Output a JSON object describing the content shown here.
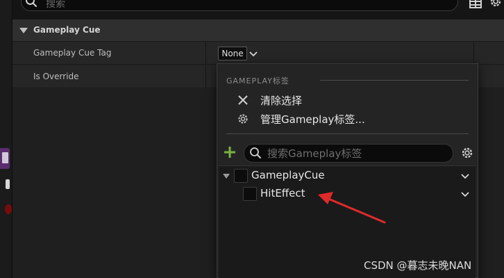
{
  "top_bar": {
    "search_placeholder": "搜索"
  },
  "details": {
    "category_title": "Gameplay Cue",
    "properties": [
      {
        "name": "Gameplay Cue Tag",
        "value": "None"
      },
      {
        "name": "Is Override"
      }
    ]
  },
  "popup": {
    "section_title": "GAMEPLAY标签",
    "menu": [
      {
        "label": "清除选择",
        "icon": "close-icon"
      },
      {
        "label": "管理Gameplay标签...",
        "icon": "gear-icon"
      }
    ],
    "search_placeholder": "搜索Gameplay标签",
    "tree": [
      {
        "label": "GameplayCue",
        "expanded": true,
        "checked": false
      },
      {
        "label": "HitEffect",
        "expanded": false,
        "checked": false
      }
    ]
  },
  "colors": {
    "background": "#151515",
    "panel": "#232323",
    "popup": "#242424",
    "add_icon": "#7ab342",
    "annotation_arrow": "#e02a2a"
  },
  "watermark": "CSDN @暮志未晚NAN"
}
